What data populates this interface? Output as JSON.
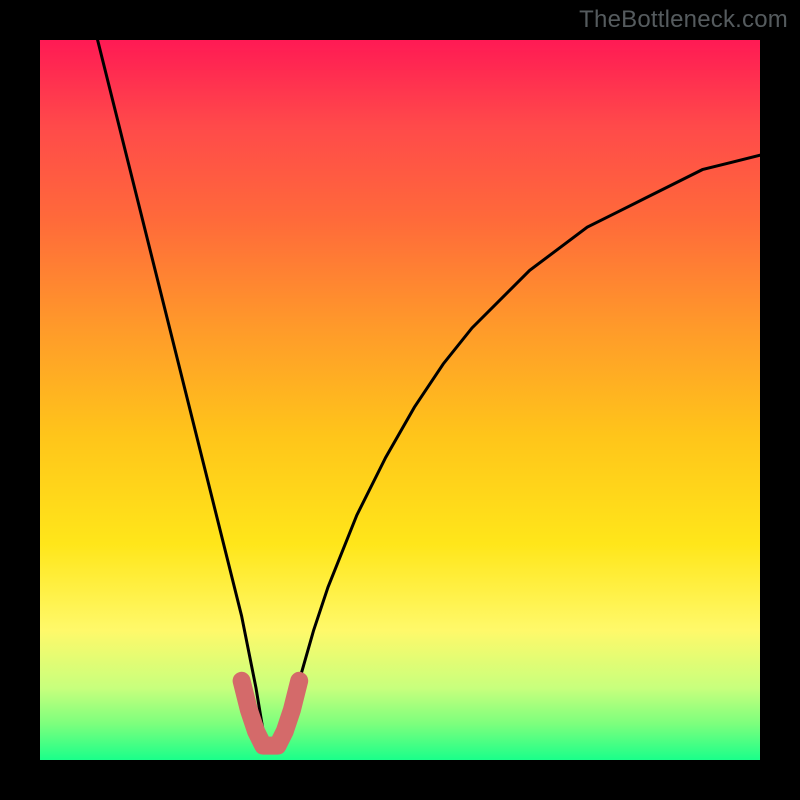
{
  "watermark": "TheBottleneck.com",
  "chart_data": {
    "type": "line",
    "title": "",
    "xlabel": "",
    "ylabel": "",
    "xlim": [
      0,
      100
    ],
    "ylim": [
      0,
      100
    ],
    "series": [
      {
        "name": "bottleneck-curve",
        "x": [
          8,
          10,
          12,
          14,
          16,
          18,
          20,
          22,
          24,
          26,
          28,
          30,
          31,
          32,
          33,
          34,
          36,
          38,
          40,
          44,
          48,
          52,
          56,
          60,
          64,
          68,
          72,
          76,
          80,
          84,
          88,
          92,
          96,
          100
        ],
        "values": [
          100,
          92,
          84,
          76,
          68,
          60,
          52,
          44,
          36,
          28,
          20,
          10,
          4,
          2,
          2,
          4,
          11,
          18,
          24,
          34,
          42,
          49,
          55,
          60,
          64,
          68,
          71,
          74,
          76,
          78,
          80,
          82,
          83,
          84
        ]
      },
      {
        "name": "highlight-band",
        "x": [
          28,
          29,
          30,
          31,
          32,
          33,
          34,
          35,
          36
        ],
        "values": [
          11,
          7,
          4,
          2,
          2,
          2,
          4,
          7,
          11
        ]
      }
    ],
    "gradient_stops": [
      {
        "pos": 0,
        "color": "#ff1a54"
      },
      {
        "pos": 25,
        "color": "#ff6a3a"
      },
      {
        "pos": 55,
        "color": "#ffc51a"
      },
      {
        "pos": 82,
        "color": "#fff96a"
      },
      {
        "pos": 95,
        "color": "#7cff7d"
      },
      {
        "pos": 100,
        "color": "#1aff8a"
      }
    ]
  }
}
